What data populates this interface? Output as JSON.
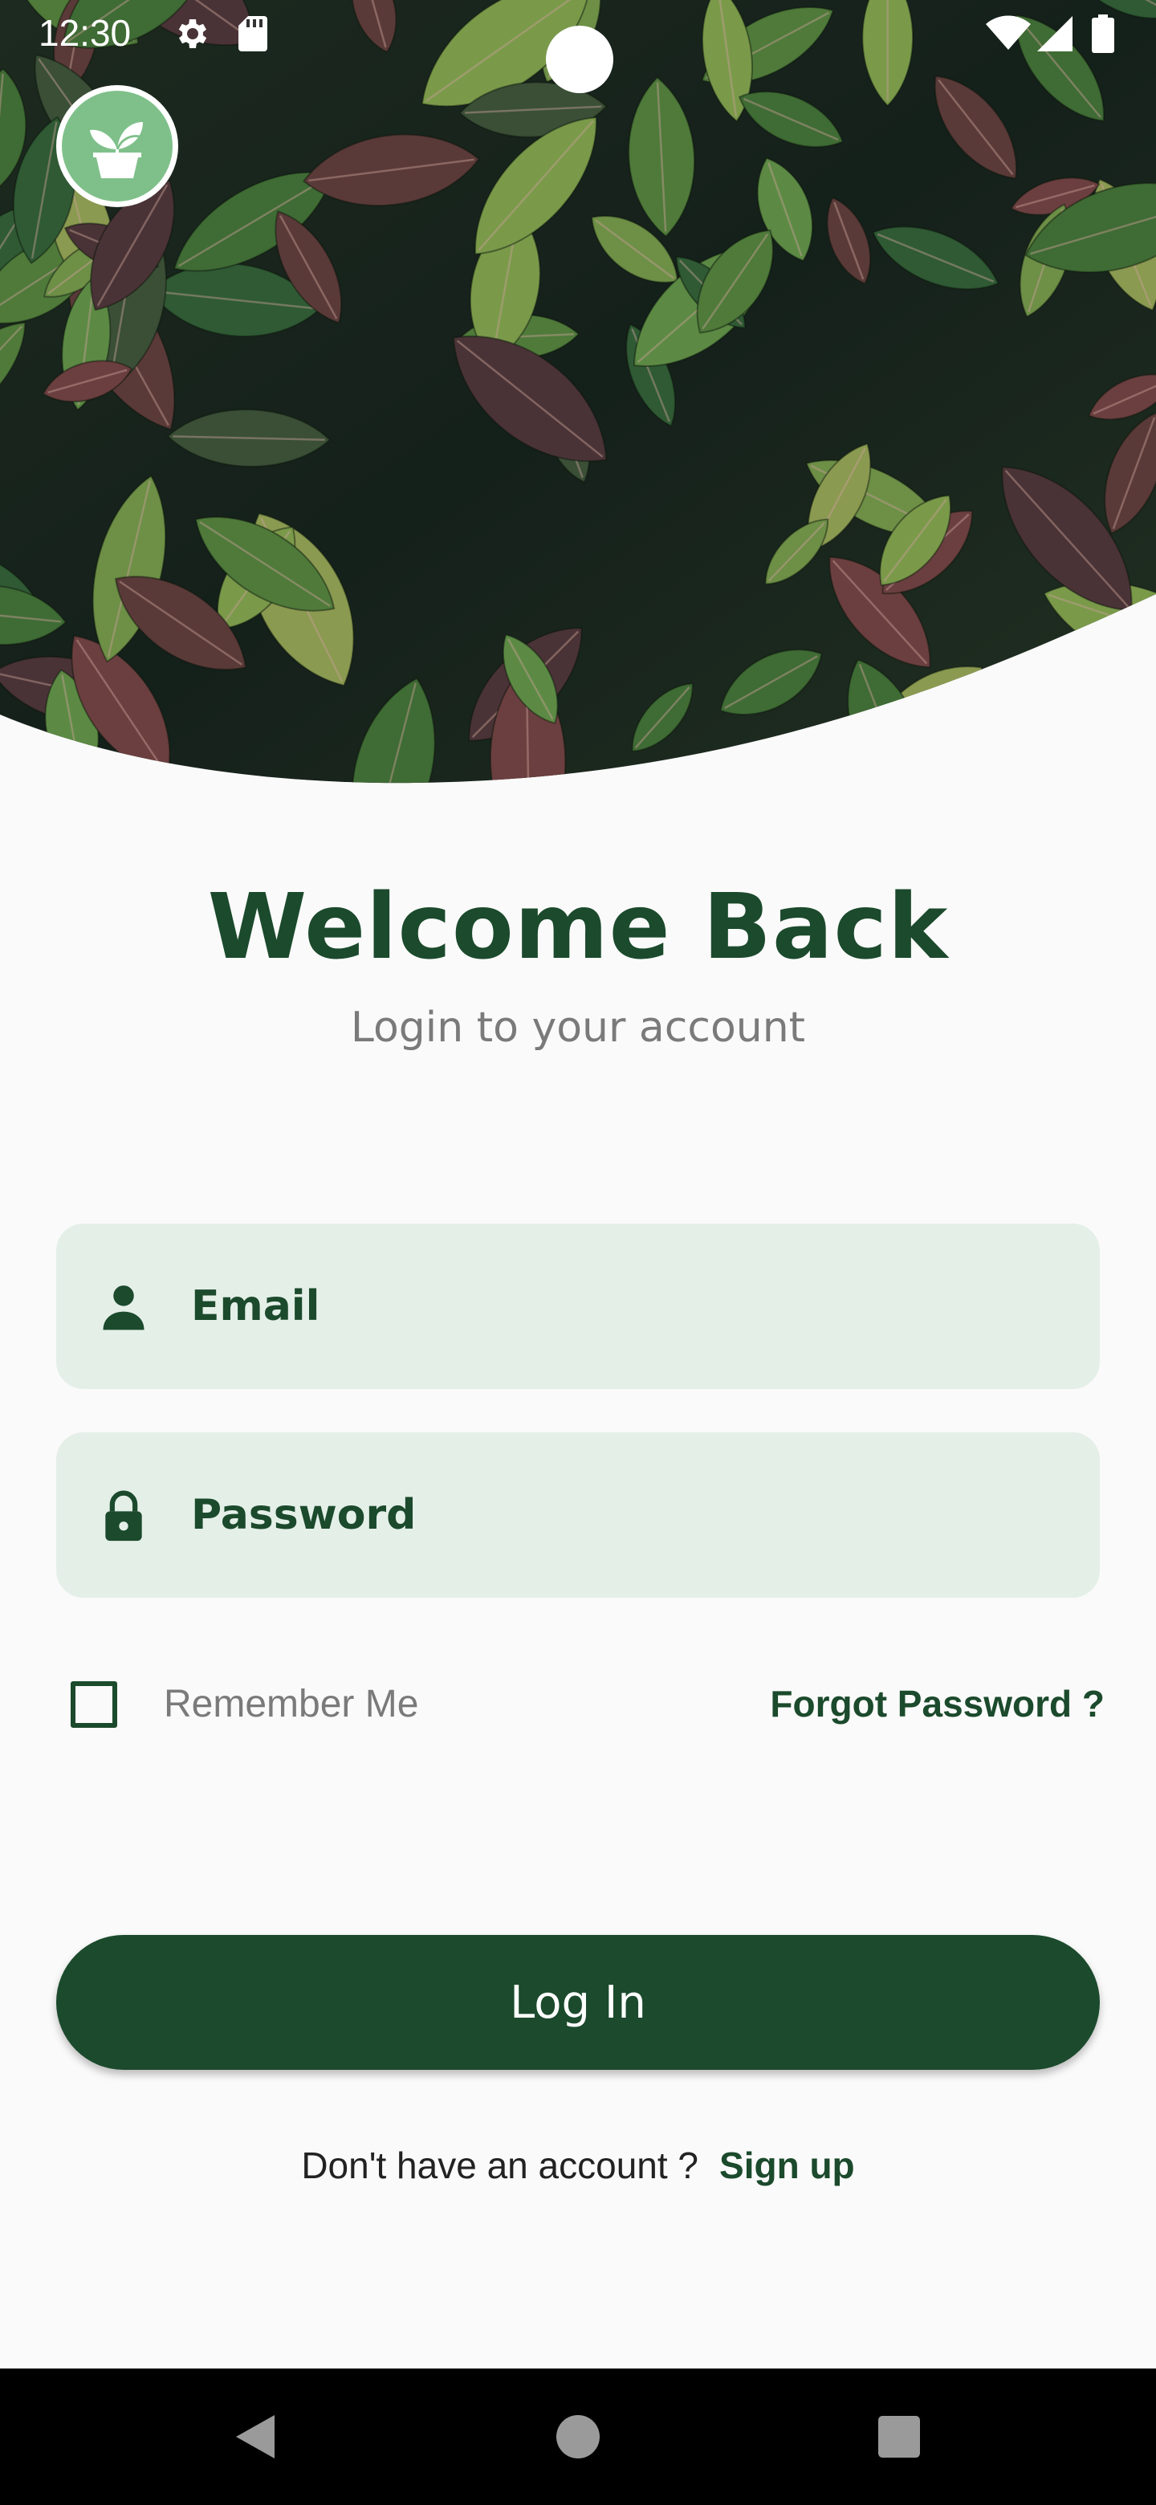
{
  "status_bar": {
    "time": "12:30",
    "icons": [
      "settings-icon",
      "sd-card-icon",
      "wifi-icon",
      "signal-icon",
      "battery-icon"
    ]
  },
  "logo": {
    "icon": "plant-pot-icon"
  },
  "header": {
    "title": "Welcome Back",
    "subtitle": "Login to your account"
  },
  "form": {
    "email": {
      "placeholder": "Email",
      "value": "",
      "icon": "person-icon"
    },
    "password": {
      "placeholder": "Password",
      "value": "",
      "icon": "lock-icon"
    },
    "remember_me": {
      "label": "Remember Me",
      "checked": false
    },
    "forgot_password": "Forgot Password ?",
    "login_button": "Log In"
  },
  "signup": {
    "prompt": "Don't have an account ?",
    "link": "Sign up"
  },
  "nav_bar": {
    "items": [
      "back-icon",
      "home-icon",
      "recents-icon"
    ]
  },
  "colors": {
    "primary": "#1b4a2c",
    "field_bg": "#e4efe8",
    "muted_text": "#7a7a7a",
    "background": "#fafafa"
  }
}
